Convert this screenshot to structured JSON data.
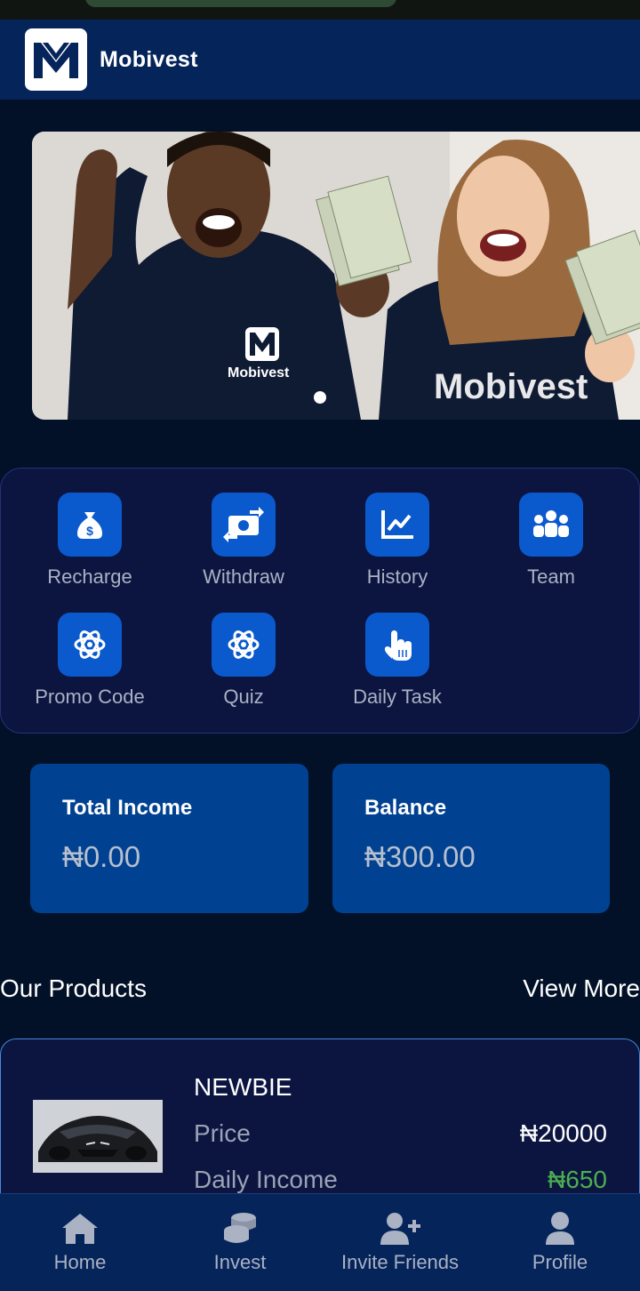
{
  "app": {
    "name": "Mobivest"
  },
  "banner": {
    "shirt_text_left": "Mobivest",
    "shirt_text_right": "Mobivest"
  },
  "actions": [
    {
      "label": "Recharge",
      "icon": "money-bag-icon"
    },
    {
      "label": "Withdraw",
      "icon": "cash-exchange-icon"
    },
    {
      "label": "History",
      "icon": "chart-line-icon"
    },
    {
      "label": "Team",
      "icon": "people-group-icon"
    },
    {
      "label": "Promo Code",
      "icon": "atom-icon"
    },
    {
      "label": "Quiz",
      "icon": "atom-icon"
    },
    {
      "label": "Daily Task",
      "icon": "hand-pointer-icon"
    }
  ],
  "stats": {
    "total_income": {
      "label": "Total Income",
      "value": "₦0.00"
    },
    "balance": {
      "label": "Balance",
      "value": "₦300.00"
    }
  },
  "products": {
    "title": "Our Products",
    "view_more": "View More",
    "items": [
      {
        "name": "NEWBIE",
        "price_label": "Price",
        "price": "₦20000",
        "income_label": "Daily Income",
        "income": "₦650"
      }
    ]
  },
  "nav": [
    {
      "label": "Home",
      "icon": "home-icon"
    },
    {
      "label": "Invest",
      "icon": "coins-icon"
    },
    {
      "label": "Invite Friends",
      "icon": "user-plus-icon"
    },
    {
      "label": "Profile",
      "icon": "user-icon"
    }
  ],
  "colors": {
    "background": "#021127",
    "header": "#05245a",
    "accent": "#0a59cd",
    "card": "#004191",
    "income_green": "#4caf50"
  }
}
